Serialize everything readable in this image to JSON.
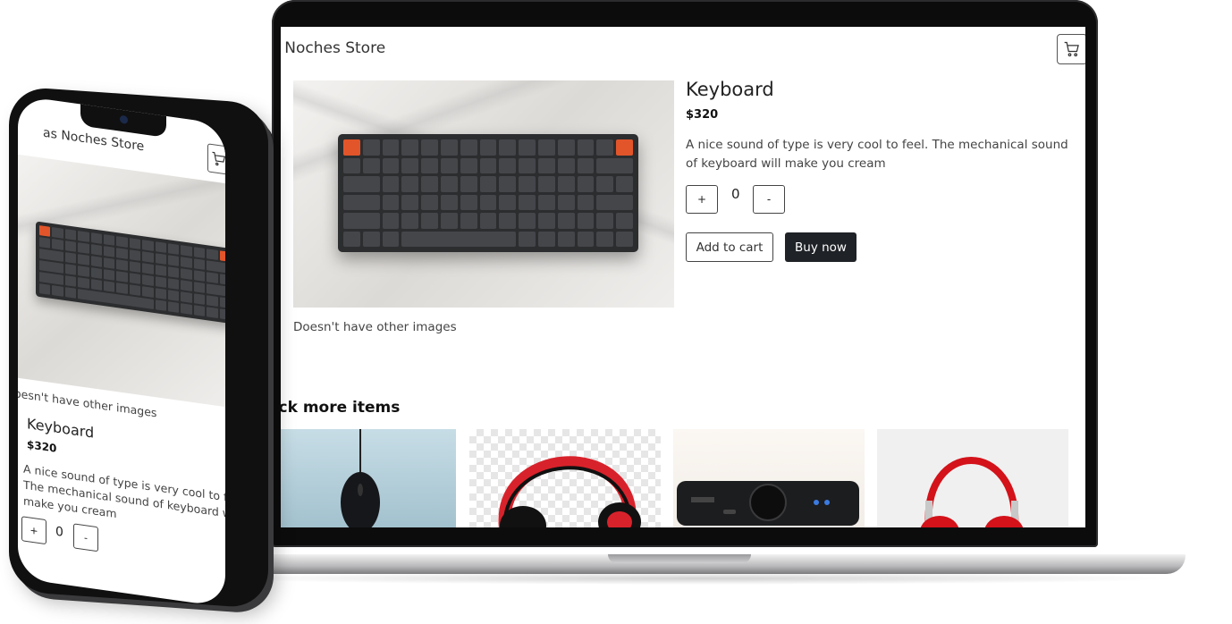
{
  "store": {
    "title": "Las Noches Store",
    "visible_title": "s Noches Store",
    "phone_visible_title": "as Noches Store"
  },
  "product": {
    "name": "Keyboard",
    "price": "$320",
    "description": "A nice sound of type is very cool to feel. The mechanical sound of keyboard will make you cream",
    "quantity": "0",
    "increment_label": "+",
    "decrement_label": "-",
    "add_to_cart_label": "Add to cart",
    "buy_now_label": "Buy now",
    "no_images_text": "Doesn't have other images",
    "phone_no_images_text": "oesn't have other images"
  },
  "more_items": {
    "title": "Check more items",
    "visible_title": "eck more items",
    "items": [
      {
        "icon": "mouse-image"
      },
      {
        "icon": "red-headphones-image"
      },
      {
        "icon": "logitech-speaker-control-image"
      },
      {
        "icon": "red-headphones-white-bg-image"
      }
    ]
  },
  "icons": {
    "cart": "cart-icon"
  },
  "colors": {
    "primary_button": "#1f2226",
    "keyboard_accent": "#e2552a",
    "device_frame": "#101011"
  }
}
